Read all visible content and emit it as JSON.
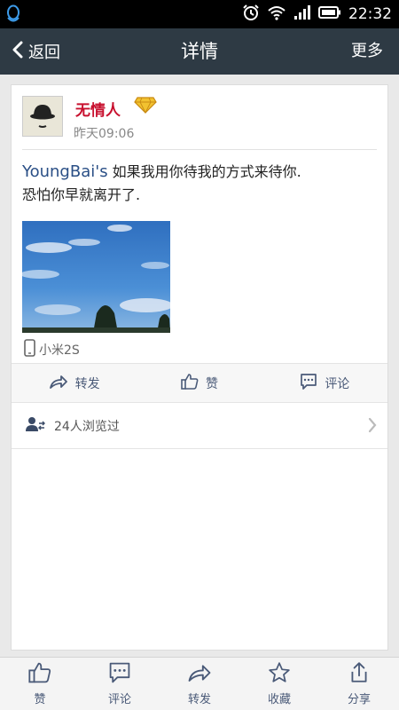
{
  "status_bar": {
    "time": "22:32",
    "icons": [
      "qq-icon",
      "alarm-icon",
      "wifi-icon",
      "signal-icon",
      "battery-icon"
    ]
  },
  "nav": {
    "back_label": "返回",
    "title": "详情",
    "more_label": "更多"
  },
  "post": {
    "username": "无情人",
    "time": "昨天09:06",
    "author_tag": "YoungBai's",
    "text_line1": "如果我用你待我的方式来待你.",
    "text_line2": "恐怕你早就离开了.",
    "device": "小米2S"
  },
  "actions": {
    "repost": "转发",
    "like": "赞",
    "comment": "评论"
  },
  "viewers": {
    "label": "24人浏览过"
  },
  "bottom_bar": {
    "like": "赞",
    "comment": "评论",
    "repost": "转发",
    "favorite": "收藏",
    "share": "分享"
  },
  "colors": {
    "nav_bg": "#2e3a44",
    "username": "#c8102e",
    "author_tag": "#2a4f86",
    "icon": "#4a5a78"
  }
}
